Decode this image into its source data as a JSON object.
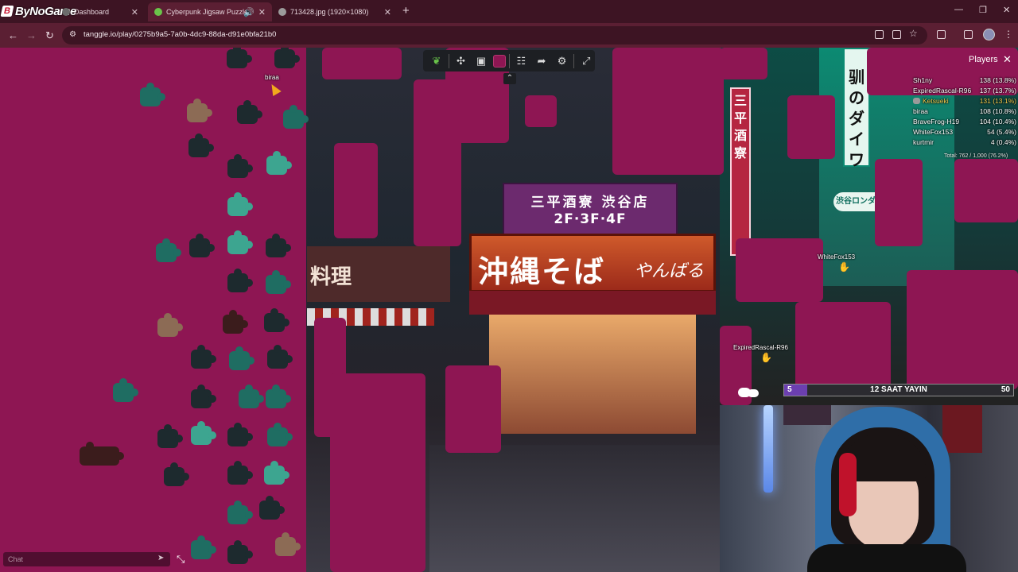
{
  "browser": {
    "logo_text": "ByNoGame",
    "tabs": [
      {
        "title": "Dashboard"
      },
      {
        "title": "Cyberpunk Jigsaw Puzzle",
        "active": true
      },
      {
        "title": "713428.jpg (1920×1080)"
      }
    ],
    "url": "tanggle.io/play/0275b9a5-7a0b-4dc9-88da-d91e0bfa21b0"
  },
  "puzzle": {
    "background_color": "#8e1653",
    "signs": {
      "purple_line1": "三平酒寮 渋谷店",
      "purple_line2": "2F·3F·4F",
      "red_main": "沖縄そば",
      "red_script": "やんばる",
      "left_sign": "料理",
      "vertical_left": "三平酒寮",
      "vertical_right": "驯のダイワ",
      "green_oval": "渋谷ロンダー劇"
    }
  },
  "toolbar": {
    "icons": [
      "leaf-icon",
      "puzzle-piece-icon",
      "image-preview-icon",
      "color-swatch",
      "players-icon",
      "share-icon",
      "settings-icon",
      "fullscreen-icon"
    ],
    "collapse_icon": "chevron-up-icon"
  },
  "players_panel": {
    "title": "Players",
    "players": [
      {
        "name": "Sh1ny",
        "score": "138 (13.8%)"
      },
      {
        "name": "ExpiredRascal-R96",
        "score": "137 (13.7%)"
      },
      {
        "name": "Ketsueki",
        "score": "131 (13.1%)",
        "is_self": true
      },
      {
        "name": "biraa",
        "score": "108 (10.8%)"
      },
      {
        "name": "BraveFrog-H19",
        "score": "104 (10.4%)"
      },
      {
        "name": "WhiteFox153",
        "score": "54 (5.4%)"
      },
      {
        "name": "kurtmir",
        "score": "4 (0.4%)"
      }
    ],
    "total": "Total: 762 / 1,000 (76.2%)"
  },
  "cursors": [
    {
      "name": "biraa"
    },
    {
      "name": "WhiteFox153"
    },
    {
      "name": "ExpiredRascal-R96"
    }
  ],
  "chat": {
    "placeholder": "Chat"
  },
  "stream_overlay": {
    "goal_current": "5",
    "goal_label": "12 SAAT YAYIN",
    "goal_target": "50",
    "goal_progress": 0.1
  }
}
